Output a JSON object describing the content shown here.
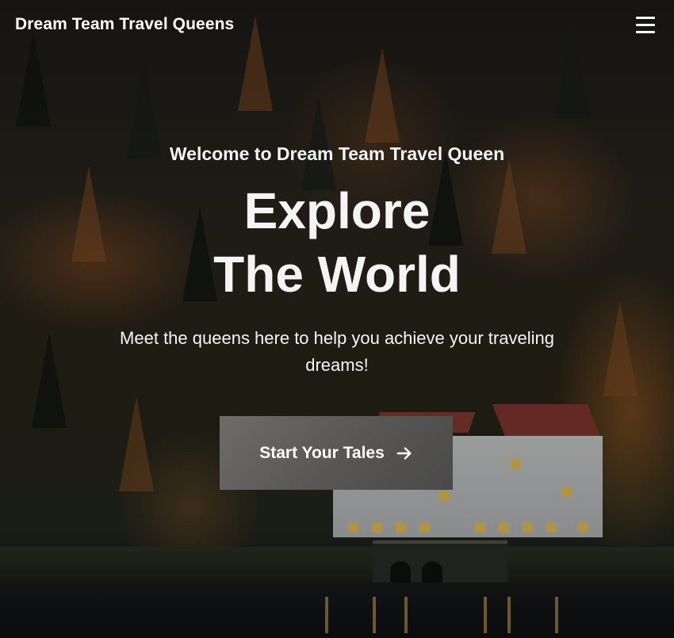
{
  "header": {
    "brand": "Dream Team Travel Queens",
    "menu_icon": "hamburger-menu-icon"
  },
  "hero": {
    "eyebrow": "Welcome to Dream Team Travel Queen",
    "headline_line1": "Explore",
    "headline_line2": "The World",
    "subtitle": "Meet the queens here to help you achieve your traveling dreams!",
    "cta_label": "Start Your Tales",
    "cta_icon": "arrow-right-icon"
  },
  "colors": {
    "text": "#ffffff",
    "button_bg": "#5f5e5d"
  }
}
